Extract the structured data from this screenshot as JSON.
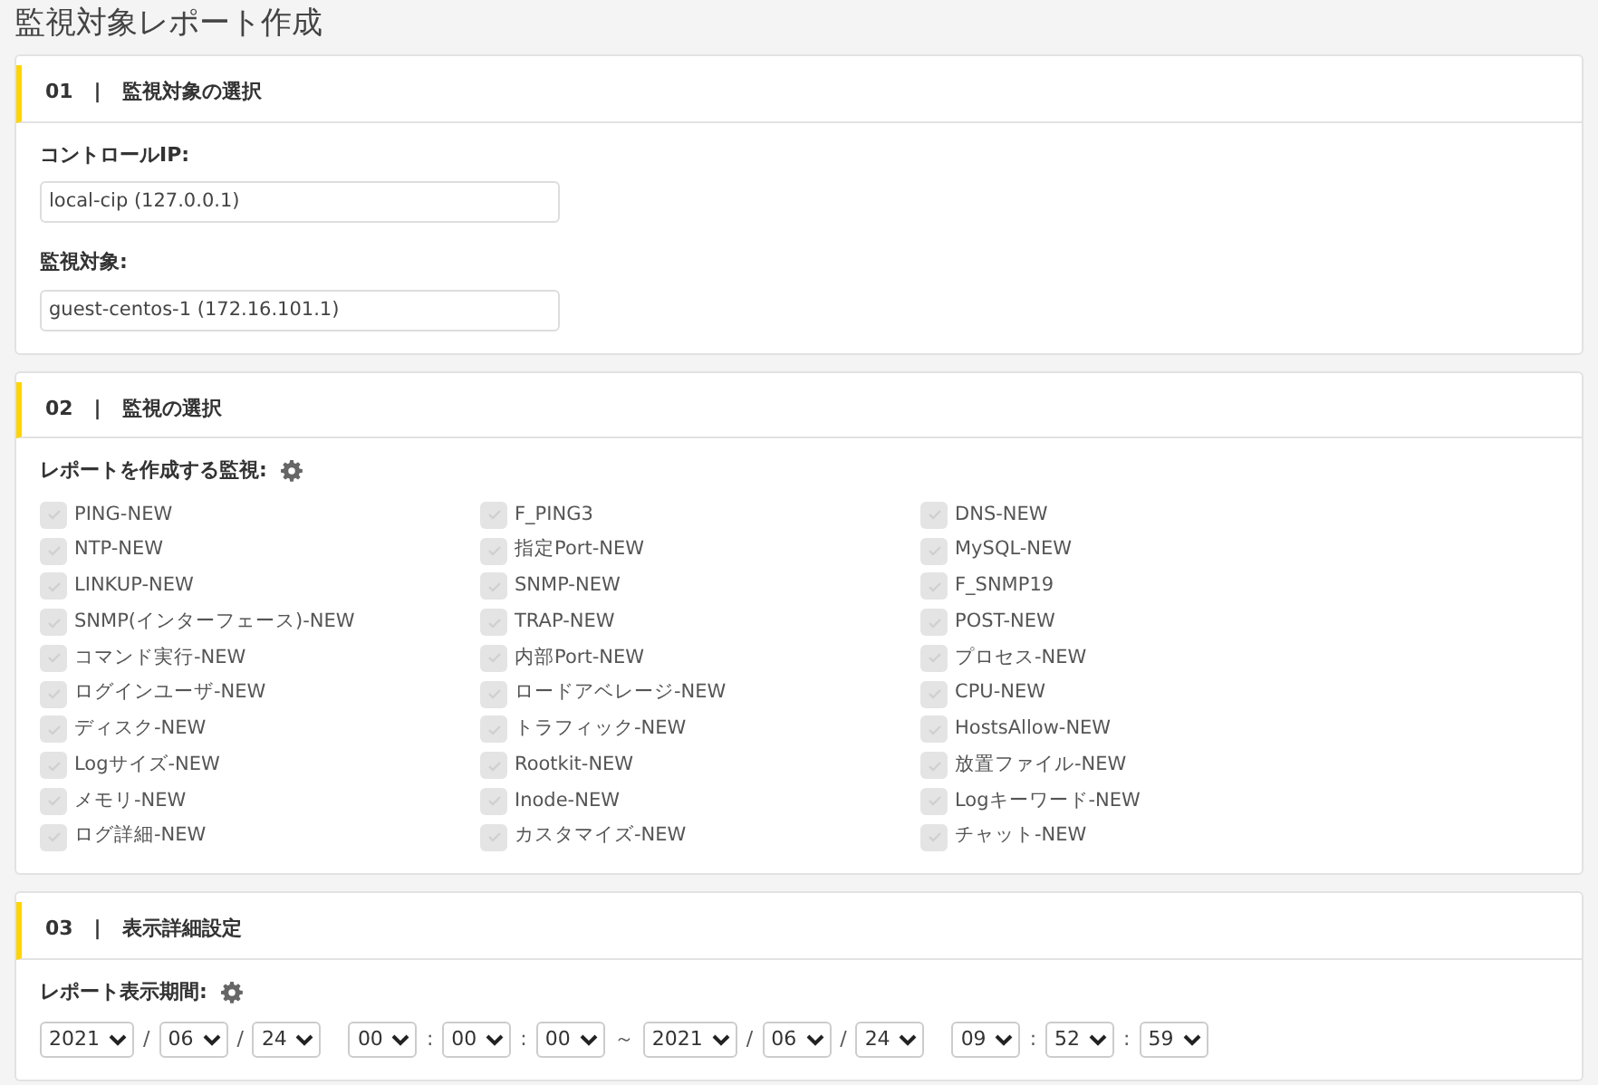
{
  "page_title": "監視対象レポート作成",
  "sections": [
    {
      "number": "01",
      "separator": "|",
      "title": "監視対象の選択",
      "kind": "fields",
      "fields": [
        {
          "label": "コントロールIP:",
          "value": "local-cip (127.0.0.1)"
        },
        {
          "label": "監視対象:",
          "value": "guest-centos-1 (172.16.101.1)"
        }
      ]
    },
    {
      "number": "02",
      "separator": "|",
      "title": "監視の選択",
      "kind": "checklist",
      "label": "レポートを作成する監視:",
      "checks": [
        {
          "label": "PING-NEW",
          "checked": false
        },
        {
          "label": "F_PING3",
          "checked": false
        },
        {
          "label": "DNS-NEW",
          "checked": false
        },
        {
          "label": "NTP-NEW",
          "checked": false
        },
        {
          "label": "指定Port-NEW",
          "checked": false
        },
        {
          "label": "MySQL-NEW",
          "checked": false
        },
        {
          "label": "LINKUP-NEW",
          "checked": false
        },
        {
          "label": "SNMP-NEW",
          "checked": false
        },
        {
          "label": "F_SNMP19",
          "checked": false
        },
        {
          "label": "SNMP(インターフェース)-NEW",
          "checked": false
        },
        {
          "label": "TRAP-NEW",
          "checked": false
        },
        {
          "label": "POST-NEW",
          "checked": false
        },
        {
          "label": "コマンド実行-NEW",
          "checked": false
        },
        {
          "label": "内部Port-NEW",
          "checked": false
        },
        {
          "label": "プロセス-NEW",
          "checked": false
        },
        {
          "label": "ログインユーザ-NEW",
          "checked": false
        },
        {
          "label": "ロードアベレージ-NEW",
          "checked": false
        },
        {
          "label": "CPU-NEW",
          "checked": false
        },
        {
          "label": "ディスク-NEW",
          "checked": false
        },
        {
          "label": "トラフィック-NEW",
          "checked": false
        },
        {
          "label": "HostsAllow-NEW",
          "checked": false
        },
        {
          "label": "Logサイズ-NEW",
          "checked": false
        },
        {
          "label": "Rootkit-NEW",
          "checked": false
        },
        {
          "label": "放置ファイル-NEW",
          "checked": false
        },
        {
          "label": "メモリ-NEW",
          "checked": false
        },
        {
          "label": "Inode-NEW",
          "checked": false
        },
        {
          "label": "Logキーワード-NEW",
          "checked": false
        },
        {
          "label": "ログ詳細-NEW",
          "checked": false
        },
        {
          "label": "カスタマイズ-NEW",
          "checked": false
        },
        {
          "label": "チャット-NEW",
          "checked": false
        }
      ]
    },
    {
      "number": "03",
      "separator": "|",
      "title": "表示詳細設定",
      "kind": "period",
      "label": "レポート表示期間:",
      "parts": [
        {
          "kind": "select",
          "value": "2021"
        },
        {
          "kind": "sep",
          "text": "/"
        },
        {
          "kind": "select",
          "value": "06"
        },
        {
          "kind": "sep",
          "text": "/"
        },
        {
          "kind": "select",
          "value": "24"
        },
        {
          "kind": "gap"
        },
        {
          "kind": "select",
          "value": "00"
        },
        {
          "kind": "sep",
          "text": ":"
        },
        {
          "kind": "select",
          "value": "00"
        },
        {
          "kind": "sep",
          "text": ":"
        },
        {
          "kind": "select",
          "value": "00"
        },
        {
          "kind": "sep",
          "text": "～"
        },
        {
          "kind": "select",
          "value": "2021"
        },
        {
          "kind": "sep",
          "text": "/"
        },
        {
          "kind": "select",
          "value": "06"
        },
        {
          "kind": "sep",
          "text": "/"
        },
        {
          "kind": "select",
          "value": "24"
        },
        {
          "kind": "gap"
        },
        {
          "kind": "select",
          "value": "09"
        },
        {
          "kind": "sep",
          "text": ":"
        },
        {
          "kind": "select",
          "value": "52"
        },
        {
          "kind": "sep",
          "text": ":"
        },
        {
          "kind": "select",
          "value": "59"
        }
      ]
    }
  ]
}
